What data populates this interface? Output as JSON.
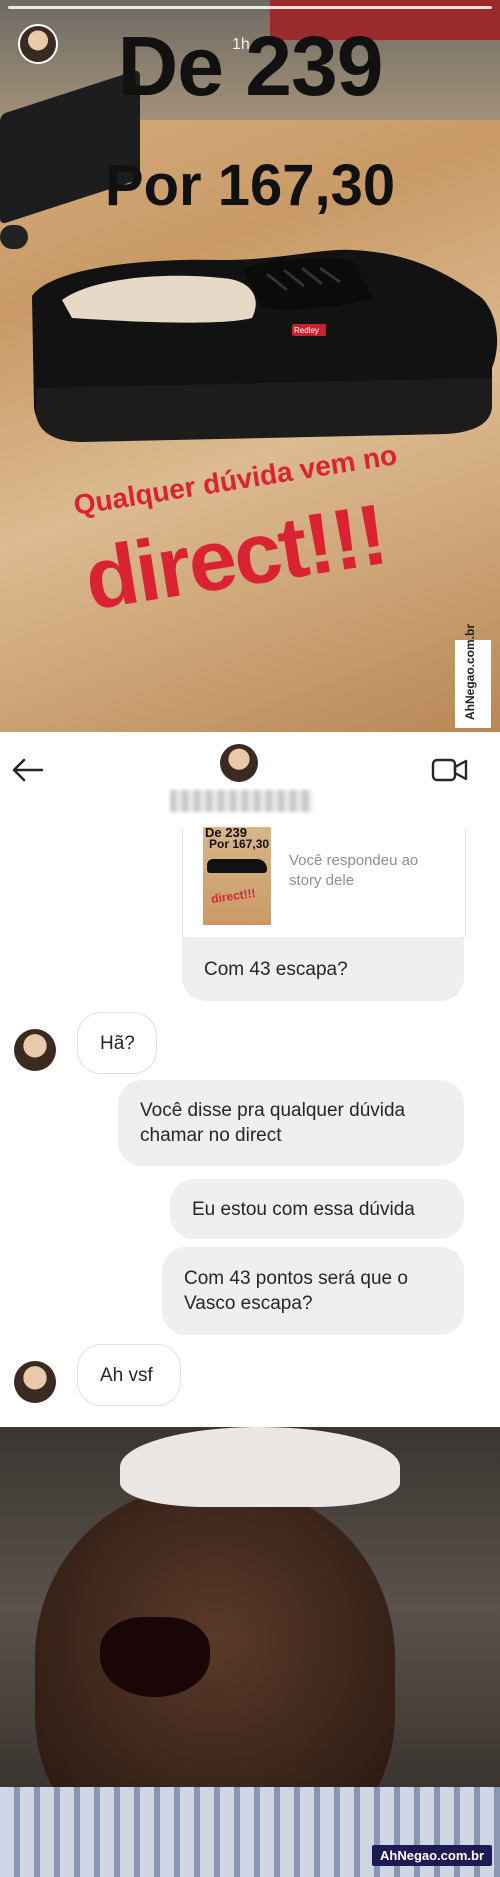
{
  "story": {
    "time_ago": "1h",
    "price_old": "De 239",
    "price_new": "Por 167,30",
    "shoe_brand": "Redley",
    "question_text": "Qualquer dúvida vem no",
    "direct_text": "direct!!!",
    "watermark": "AhNegao.com.br"
  },
  "header": {
    "back_icon": "arrow-left-icon",
    "video_icon": "video-camera-icon",
    "username": "████████████"
  },
  "reply": {
    "thumb_old": "De 239",
    "thumb_new": "Por 167,30",
    "thumb_direct": "direct!!!",
    "note": "Você respondeu ao story dele"
  },
  "messages": [
    {
      "from": "me",
      "text": "Com 43 escapa?"
    },
    {
      "from": "them",
      "text": "Hã?"
    },
    {
      "from": "me",
      "text": "Você disse pra qualquer dúvida chamar no direct"
    },
    {
      "from": "me",
      "text": "Eu estou com essa dúvida"
    },
    {
      "from": "me",
      "text": "Com 43 pontos será que o Vasco escapa?"
    },
    {
      "from": "them",
      "text": "Ah vsf"
    }
  ],
  "meme": {
    "watermark": "AhNegao.com.br"
  }
}
